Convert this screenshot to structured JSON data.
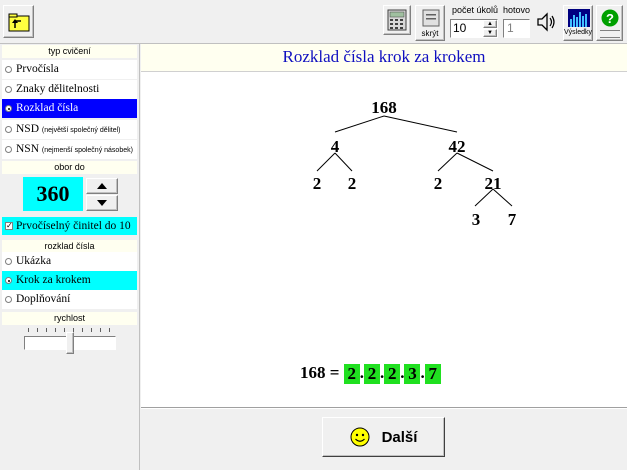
{
  "toolbar": {
    "hide_label": "skrýt",
    "task_count_label": "počet úkolů",
    "task_count_value": "10",
    "done_label": "hotovo",
    "done_value": "1",
    "results_label": "Výsledky"
  },
  "sidebar": {
    "exercise_type_title": "typ cvičení",
    "exercise_types": [
      {
        "label": "Prvočísla",
        "note": ""
      },
      {
        "label": "Znaky dělitelnosti",
        "note": ""
      },
      {
        "label": "Rozklad čísla",
        "note": ""
      },
      {
        "label": "NSD",
        "note": "(největší společný dělitel)"
      },
      {
        "label": "NSN",
        "note": "(nejmenší společný násobek)"
      }
    ],
    "range_title": "obor do",
    "range_value": "360",
    "prime_factor_checkbox": "Prvočíselný činitel do 10",
    "decomposition_title": "rozklad čísla",
    "modes": [
      "Ukázka",
      "Krok za krokem",
      "Doplňování"
    ],
    "speed_title": "rychlost"
  },
  "main": {
    "title": "Rozklad čísla krok za krokem",
    "tree": {
      "root": "168",
      "l1_left": "4",
      "l1_right": "42",
      "l2_a": "2",
      "l2_b": "2",
      "l2_c": "2",
      "l2_d": "21",
      "l3_a": "3",
      "l3_b": "7"
    },
    "result_lhs": "168 =",
    "result_factors": [
      "2",
      "2",
      "2",
      "3",
      "7"
    ],
    "next_button": "Další"
  },
  "colors": {
    "selected_blue": "#0000ff",
    "cyan": "#00ffff",
    "green": "#20e020",
    "title_blue": "#1010c0"
  }
}
